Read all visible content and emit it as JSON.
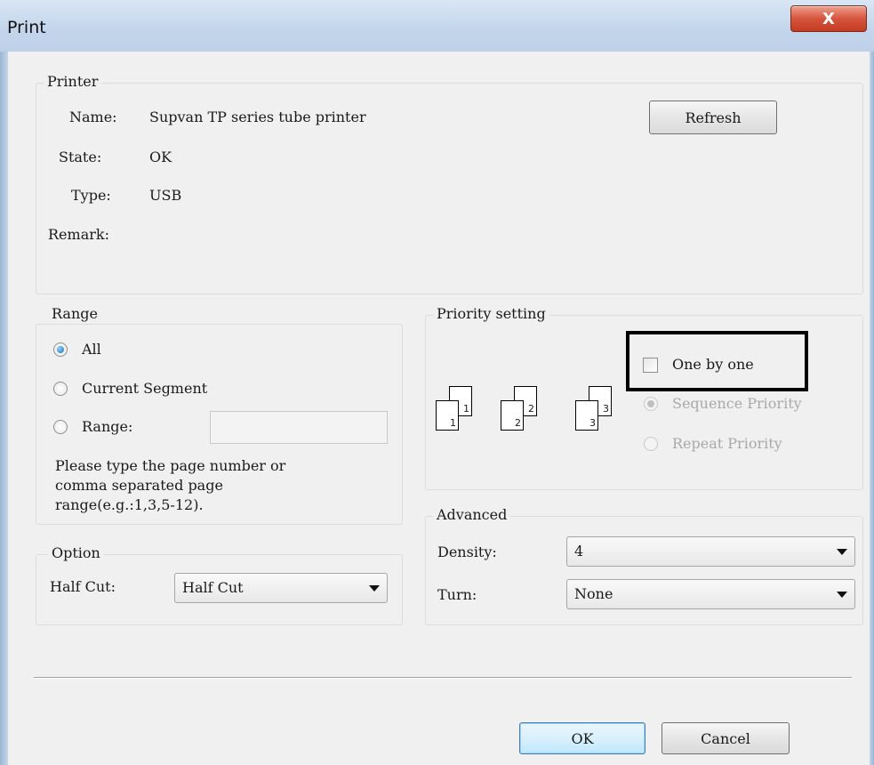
{
  "window": {
    "title": "Print",
    "close_glyph": "X"
  },
  "printer": {
    "legend": "Printer",
    "name_label": "Name:",
    "name_value": "Supvan TP series tube printer",
    "state_label": "State:",
    "state_value": "OK",
    "type_label": "Type:",
    "type_value": "USB",
    "remark_label": "Remark:",
    "refresh_button": "Refresh"
  },
  "range": {
    "legend": "Range",
    "all_label": "All",
    "current_segment_label": "Current Segment",
    "range_label": "Range:",
    "range_value": "",
    "help_text_line1": "Please type the page number or",
    "help_text_line2": "comma separated page",
    "help_text_line3": "range(e.g.:1,3,5-12).",
    "selected": "All"
  },
  "option": {
    "legend": "Option",
    "half_cut_label": "Half Cut:",
    "half_cut_value": "Half Cut"
  },
  "priority": {
    "legend": "Priority setting",
    "one_by_one_label": "One by one",
    "one_by_one_checked": false,
    "sequence_label": "Sequence Priority",
    "repeat_label": "Repeat Priority",
    "icon_groups": [
      {
        "back": "1",
        "front": "1"
      },
      {
        "back": "2",
        "front": "2"
      },
      {
        "back": "3",
        "front": "3"
      }
    ]
  },
  "advanced": {
    "legend": "Advanced",
    "density_label": "Density:",
    "density_value": "4",
    "turn_label": "Turn:",
    "turn_value": "None"
  },
  "footer": {
    "ok_button": "OK",
    "cancel_button": "Cancel"
  },
  "icons": {
    "close": "close-icon",
    "dropdown": "chevron-down-icon",
    "pages": "page-stack-icon"
  }
}
